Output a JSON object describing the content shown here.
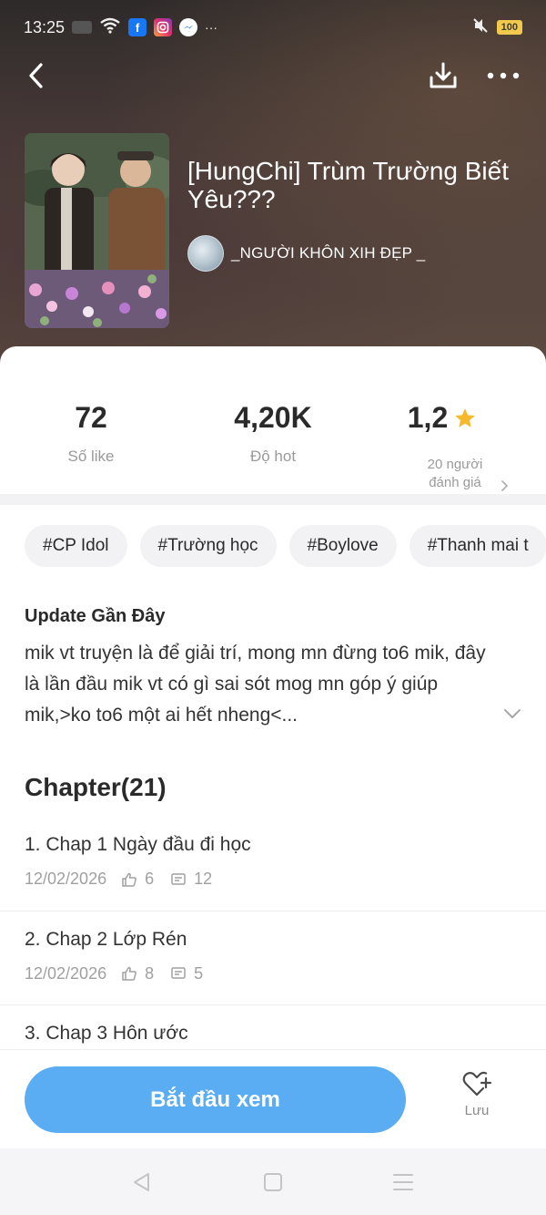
{
  "status_bar": {
    "time": "13:25",
    "battery": "100",
    "more": "···"
  },
  "story": {
    "title": "[HungChi] Trùm Trường Biết Yêu???",
    "author": "_NGƯỜI KHÔN XIH ĐẸP _"
  },
  "stats": {
    "likes": {
      "value": "72",
      "label": "Số like"
    },
    "hot": {
      "value": "4,20K",
      "label": "Độ hot"
    },
    "rating": {
      "value": "1,2",
      "count_label": "20 người đánh giá"
    }
  },
  "tags": [
    "#CP Idol",
    "#Trường học",
    "#Boylove",
    "#Thanh mai t"
  ],
  "update": {
    "title": "Update Gần Đây",
    "text": "mik vt truyện là để giải trí, mong mn đừng to6 mik, đây là lần đầu mik vt có gì sai sót mog mn góp ý giúp mik,>ko to6 một ai hết nheng<..."
  },
  "chapters_header": "Chapter(21)",
  "chapters": [
    {
      "title": "1. Chap 1 Ngày đầu đi học",
      "date": "12/02/2026",
      "likes": "6",
      "comments": "12"
    },
    {
      "title": "2. Chap 2 Lớp Rén",
      "date": "12/02/2026",
      "likes": "8",
      "comments": "5"
    },
    {
      "title": "3. Chap 3 Hôn ước",
      "date": "",
      "likes": "",
      "comments": ""
    }
  ],
  "actions": {
    "start_label": "Bắt đầu xem",
    "save_label": "Lưu"
  },
  "colors": {
    "accent": "#5aacf3",
    "star": "#f5b92e"
  },
  "icons": [
    "back-icon",
    "download-icon",
    "more-icon",
    "star-icon",
    "chevron-right-icon",
    "chevron-down-icon",
    "like-icon",
    "comment-icon",
    "heart-plus-icon"
  ]
}
